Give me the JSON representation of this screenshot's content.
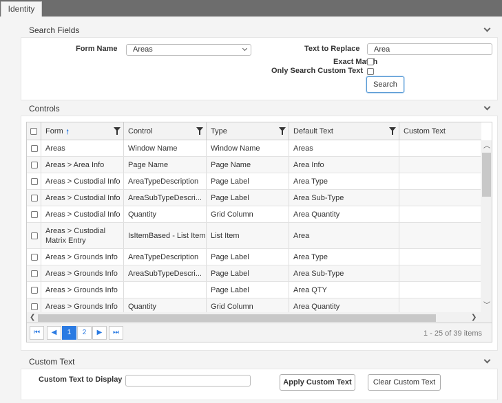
{
  "tabs": {
    "identity": "Identity"
  },
  "search_section": {
    "title": "Search Fields",
    "form_name_label": "Form Name",
    "form_name_value": "Areas",
    "text_to_replace_label": "Text to Replace",
    "text_to_replace_value": "Area",
    "exact_match_label": "Exact Match",
    "only_custom_label": "Only Search Custom Text",
    "search_button": "Search"
  },
  "controls_section": {
    "title": "Controls",
    "columns": [
      "Form",
      "Control",
      "Type",
      "Default Text",
      "Custom Text"
    ],
    "rows": [
      [
        "Areas",
        "Window Name",
        "Window Name",
        "Areas",
        ""
      ],
      [
        "Areas > Area Info",
        "Page Name",
        "Page Name",
        "Area Info",
        ""
      ],
      [
        "Areas > Custodial Info",
        "AreaTypeDescription",
        "Page Label",
        "Area Type",
        ""
      ],
      [
        "Areas > Custodial Info",
        "AreaSubTypeDescri...",
        "Page Label",
        "Area Sub-Type",
        ""
      ],
      [
        "Areas > Custodial Info",
        "Quantity",
        "Grid Column",
        "Area Quantity",
        ""
      ],
      [
        "Areas > Custodial Matrix Entry",
        "IsItemBased - List Item",
        "List Item",
        "Area",
        ""
      ],
      [
        "Areas > Grounds Info",
        "AreaTypeDescription",
        "Page Label",
        "Area Type",
        ""
      ],
      [
        "Areas > Grounds Info",
        "AreaSubTypeDescri...",
        "Page Label",
        "Area Sub-Type",
        ""
      ],
      [
        "Areas > Grounds Info",
        "",
        "Page Label",
        "Area QTY",
        ""
      ],
      [
        "Areas > Grounds Info",
        "Quantity",
        "Grid Column",
        "Area Quantity",
        ""
      ]
    ],
    "pager": {
      "pages": [
        "1",
        "2"
      ],
      "current_page": 1,
      "info": "1 - 25 of 39 items"
    }
  },
  "custom_section": {
    "title": "Custom Text",
    "display_label": "Custom Text to Display",
    "display_value": "",
    "apply_button": "Apply Custom Text",
    "clear_button": "Clear Custom Text"
  },
  "colors": {
    "accent": "#2a7ae2",
    "topbar": "#6d6d6d"
  }
}
